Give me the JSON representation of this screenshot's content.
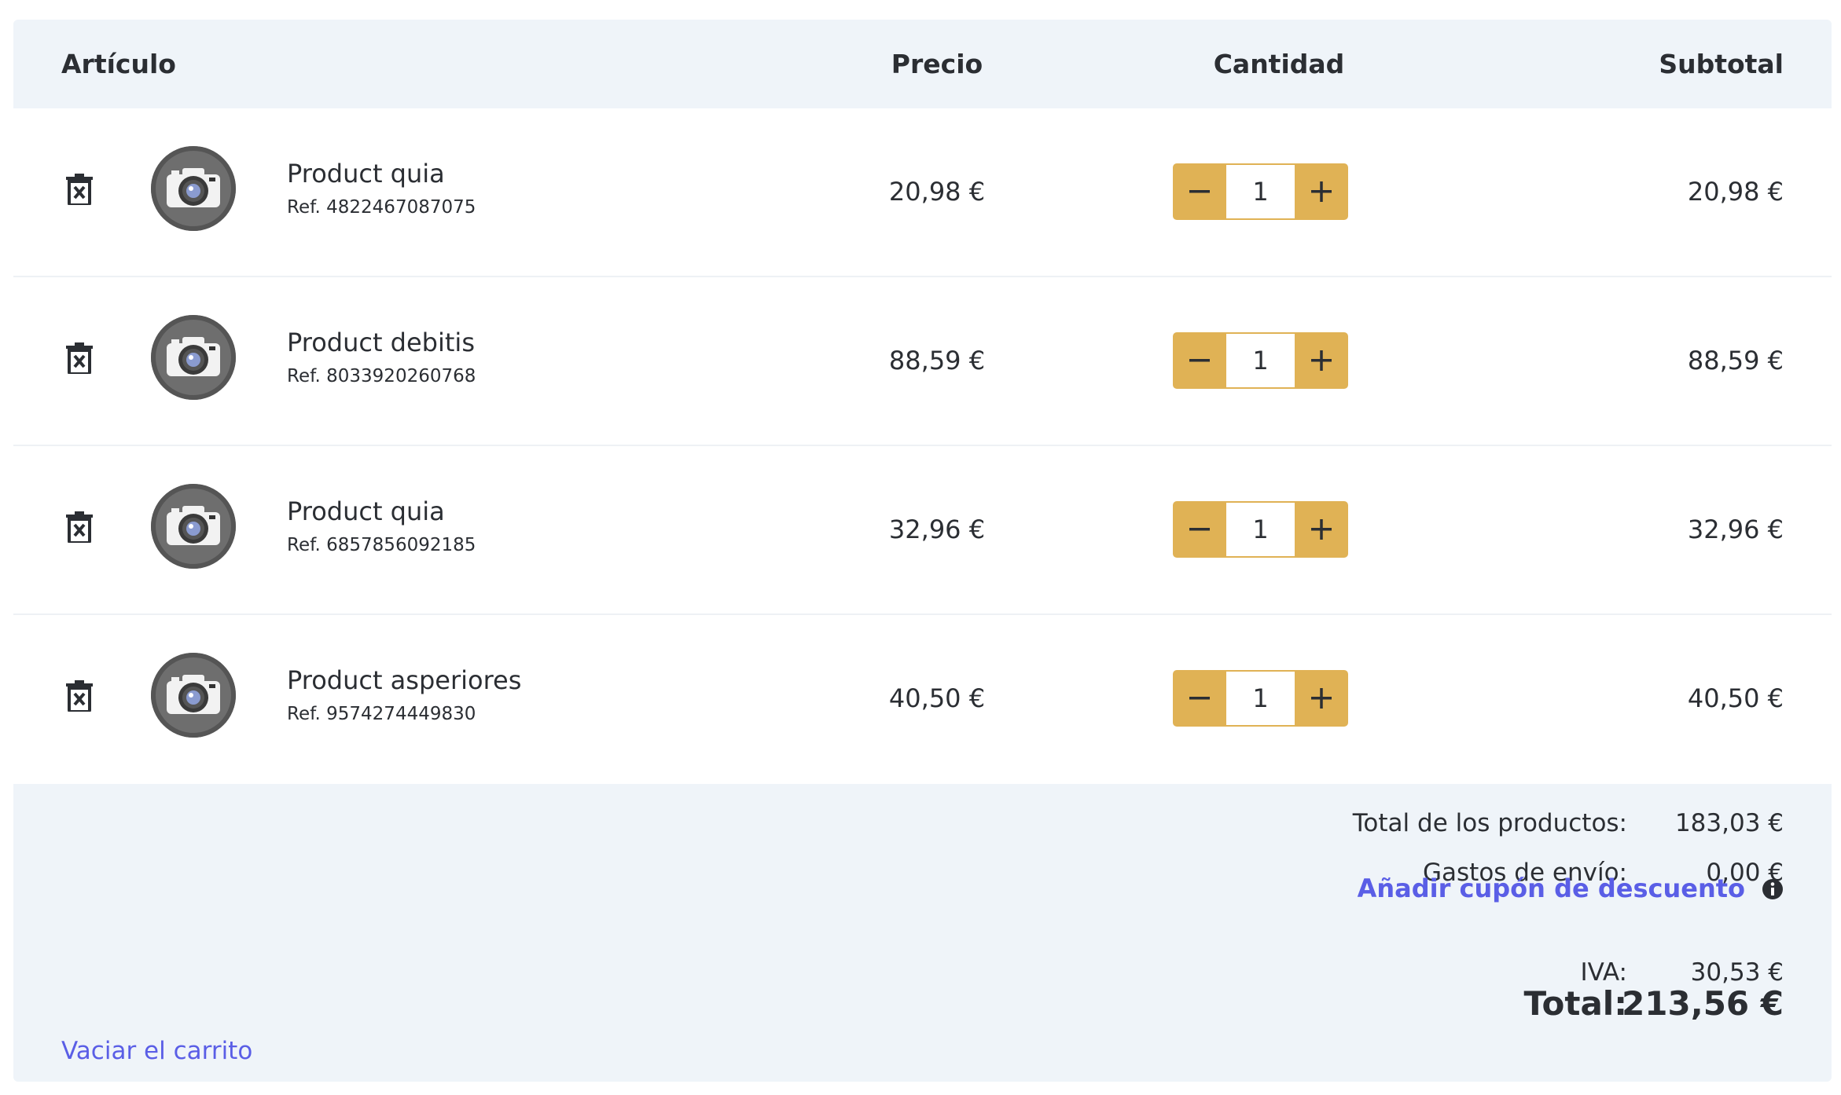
{
  "header": {
    "article": "Artículo",
    "price": "Precio",
    "quantity": "Cantidad",
    "subtotal": "Subtotal"
  },
  "items": [
    {
      "name": "Product quia",
      "ref": "Ref. 4822467087075",
      "price": "20,98 €",
      "qty": "1",
      "subtotal": "20,98 €",
      "image_icon": "camera-icon"
    },
    {
      "name": "Product debitis",
      "ref": "Ref. 8033920260768",
      "price": "88,59 €",
      "qty": "1",
      "subtotal": "88,59 €",
      "image_icon": "camera-icon"
    },
    {
      "name": "Product quia",
      "ref": "Ref. 6857856092185",
      "price": "32,96 €",
      "qty": "1",
      "subtotal": "32,96 €",
      "image_icon": "camera-icon"
    },
    {
      "name": "Product asperiores",
      "ref": "Ref. 9574274449830",
      "price": "40,50 €",
      "qty": "1",
      "subtotal": "40,50 €",
      "image_icon": "camera-icon"
    }
  ],
  "summary": {
    "products_label": "Total de los productos:",
    "products_value": "183,03 €",
    "shipping_label": "Gastos de envío:",
    "shipping_value": "0,00 €",
    "coupon_link": "Añadir cupón de descuento",
    "vat_label": "IVA:",
    "vat_value": "30,53 €",
    "total_label": "Total:",
    "total_value": "213,56 €"
  },
  "empty_cart": "Vaciar el carrito",
  "icons": {
    "remove": "trash-icon",
    "decrement": "minus-icon",
    "increment": "plus-icon",
    "info": "info-icon"
  },
  "colors": {
    "stepper": "#e0b255",
    "link": "#5a5ee6",
    "panel_bg": "#eff4f9",
    "text": "#2b2e33"
  }
}
